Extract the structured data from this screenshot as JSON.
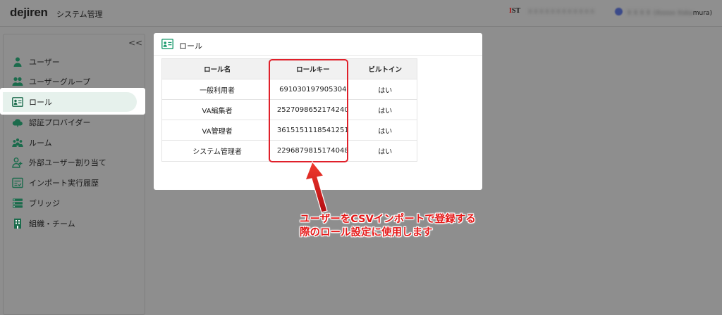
{
  "header": {
    "logo": "dejiren",
    "app_title": "システム管理",
    "org_mark": "IST",
    "org_name_blurred": "ＸＸＸＸＸＸＸＸＸＸＸＸ",
    "user_name_blurred": "ＸＸＸＸ (Xxxxx Xxka",
    "user_name_tail": "mura)"
  },
  "sidebar": {
    "collapse_label": "<<",
    "items": [
      {
        "label": "ユーザー",
        "icon": "user-icon"
      },
      {
        "label": "ユーザーグループ",
        "icon": "user-group-icon"
      },
      {
        "label": "ロール",
        "icon": "role-card-icon",
        "active": true
      },
      {
        "label": "認証プロバイダー",
        "icon": "cloud-auth-icon"
      },
      {
        "label": "ルーム",
        "icon": "room-people-icon"
      },
      {
        "label": "外部ユーザー割り当て",
        "icon": "external-user-icon"
      },
      {
        "label": "インポート実行履歴",
        "icon": "import-history-icon"
      },
      {
        "label": "ブリッジ",
        "icon": "bridge-icon"
      },
      {
        "label": "組織・チーム",
        "icon": "building-icon"
      }
    ]
  },
  "card": {
    "title": "ロール",
    "table": {
      "headers": [
        "ロール名",
        "ロールキー",
        "ビルトイン"
      ],
      "rows": [
        [
          "一般利用者",
          "691030197905304",
          "はい"
        ],
        [
          "VA編集者",
          "2527098652174240",
          "はい"
        ],
        [
          "VA管理者",
          "3615151118541251",
          "はい"
        ],
        [
          "システム管理者",
          "2296879815174048",
          "はい"
        ]
      ]
    }
  },
  "annotation": {
    "line1": "ユーザーをCSVインポートで登録する",
    "line2": "際のロール設定に使用します",
    "color": "#e51919"
  },
  "colors": {
    "accent": "#1a9a6c",
    "active_bg": "#e6f1ec",
    "highlight": "#e0202a",
    "overlay": "#8e8e8e"
  }
}
